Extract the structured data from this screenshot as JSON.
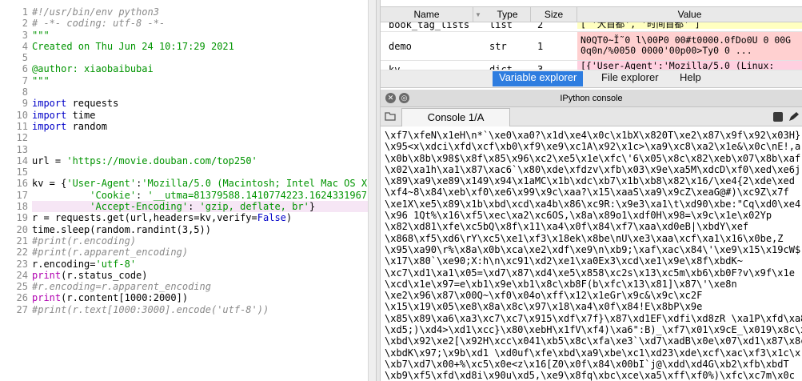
{
  "editor": {
    "lines": [
      {
        "n": "1",
        "parts": [
          {
            "c": "cm",
            "t": "#!/usr/bin/env python3"
          }
        ]
      },
      {
        "n": "2",
        "parts": [
          {
            "c": "cm",
            "t": "# -*- coding: utf-8 -*-"
          }
        ]
      },
      {
        "n": "3",
        "parts": [
          {
            "c": "str",
            "t": "\"\"\""
          }
        ]
      },
      {
        "n": "4",
        "parts": [
          {
            "c": "str",
            "t": "Created on Thu Jun 24 10:17:29 2021"
          }
        ]
      },
      {
        "n": "5",
        "parts": []
      },
      {
        "n": "6",
        "parts": [
          {
            "c": "str",
            "t": "@author: xiaobaibubai"
          }
        ]
      },
      {
        "n": "7",
        "parts": [
          {
            "c": "str",
            "t": "\"\"\""
          }
        ]
      },
      {
        "n": "8",
        "parts": []
      },
      {
        "n": "9",
        "parts": [
          {
            "c": "kw",
            "t": "import"
          },
          {
            "c": "",
            "t": " requests"
          }
        ]
      },
      {
        "n": "10",
        "parts": [
          {
            "c": "kw",
            "t": "import"
          },
          {
            "c": "",
            "t": " time"
          }
        ]
      },
      {
        "n": "11",
        "parts": [
          {
            "c": "kw",
            "t": "import"
          },
          {
            "c": "",
            "t": " random"
          }
        ]
      },
      {
        "n": "12",
        "parts": []
      },
      {
        "n": "13",
        "parts": []
      },
      {
        "n": "14",
        "parts": [
          {
            "c": "",
            "t": "url = "
          },
          {
            "c": "str",
            "t": "'https://movie.douban.com/top250'"
          }
        ]
      },
      {
        "n": "15",
        "parts": []
      },
      {
        "n": "16",
        "parts": [
          {
            "c": "",
            "t": "kv = {"
          },
          {
            "c": "str",
            "t": "'User-Agent'"
          },
          {
            "c": "",
            "t": ":"
          },
          {
            "c": "str",
            "t": "'Mozilla/5.0 (Macintosh; Intel Mac OS X"
          }
        ]
      },
      {
        "n": "17",
        "parts": [
          {
            "c": "",
            "t": "          "
          },
          {
            "c": "str",
            "t": "'Cookie'"
          },
          {
            "c": "",
            "t": ": "
          },
          {
            "c": "str",
            "t": "'__utma=81379588.1410774223.1624331967"
          }
        ]
      },
      {
        "n": "18",
        "hl": true,
        "parts": [
          {
            "c": "",
            "t": "          "
          },
          {
            "c": "str",
            "t": "'Accept-Encoding'"
          },
          {
            "c": "",
            "t": ": "
          },
          {
            "c": "str",
            "t": "'gzip, deflate, br'"
          },
          {
            "c": "",
            "t": "}"
          }
        ]
      },
      {
        "n": "19",
        "parts": [
          {
            "c": "",
            "t": "r = requests.get(url,headers=kv,verify="
          },
          {
            "c": "kw",
            "t": "False"
          },
          {
            "c": "",
            "t": ")"
          }
        ]
      },
      {
        "n": "20",
        "parts": [
          {
            "c": "",
            "t": "time.sleep(random.randint(3,5))"
          }
        ]
      },
      {
        "n": "21",
        "parts": [
          {
            "c": "cm",
            "t": "#print(r.encoding)"
          }
        ]
      },
      {
        "n": "22",
        "parts": [
          {
            "c": "cm",
            "t": "#print(r.apparent_encoding)"
          }
        ]
      },
      {
        "n": "23",
        "parts": [
          {
            "c": "",
            "t": "r.encoding="
          },
          {
            "c": "str",
            "t": "'utf-8'"
          }
        ]
      },
      {
        "n": "24",
        "parts": [
          {
            "c": "ca",
            "t": "print"
          },
          {
            "c": "",
            "t": "(r.status_code)"
          }
        ]
      },
      {
        "n": "25",
        "parts": [
          {
            "c": "cm",
            "t": "#r.encoding=r.apparent_encoding"
          }
        ]
      },
      {
        "n": "26",
        "parts": [
          {
            "c": "ca",
            "t": "print"
          },
          {
            "c": "",
            "t": "(r.content[1000:2000])"
          }
        ]
      },
      {
        "n": "27",
        "parts": [
          {
            "c": "cm",
            "t": "#print(r.text[1000:3000].encode('utf-8'))"
          }
        ]
      }
    ]
  },
  "variable_explorer": {
    "columns": {
      "name": "Name",
      "type": "Type",
      "size": "Size",
      "value": "Value"
    },
    "rows": [
      {
        "name": "book_tag_lists",
        "type": "list",
        "size": "2",
        "value": "[ '大首都', '时间首都' ]",
        "color": "yellow"
      },
      {
        "name": "demo",
        "type": "str",
        "size": "1",
        "value": "N0QT0~Ĭ̃ 0 l\\00P0 00#t0000.0fDo0U 0 00G\n0q0n/%0050 0000'00p00>Ty0 0 ...",
        "color": "red"
      },
      {
        "name": "kv",
        "type": "dict",
        "size": "3",
        "value": "[{'User-Agent':'Mozilla/5.0 (Linux:",
        "color": "pink"
      }
    ]
  },
  "pane_tabs": [
    "Variable explorer",
    "File explorer",
    "Help"
  ],
  "console": {
    "title": "IPython console",
    "tab_label": "Console 1/A",
    "output": [
      "\\xf7\\xfeN\\x1eH\\n*`\\xe0\\xa0?\\x1d\\xe4\\x0c\\x1bX\\x820T\\xe2\\x87\\x9f\\x92\\x03H}",
      "\\x95<x\\xdci\\xfd\\xcf\\xb0\\xf9\\xe9\\xc1A\\x92\\x1c>\\xa9\\xc8\\xa2\\x1e&\\x0c\\nE!,a",
      "\\x0b\\x8b\\x98$\\x8f\\x85\\x96\\xc2\\xe5\\x1e\\xfc\\'6\\x05\\x8c\\x82\\xeb\\x07\\x8b\\xaf",
      "\\x02\\xa1h\\xa1\\x87\\xac6`\\x80\\xde\\xfdzv\\xfb\\x03\\x9e\\xa5M\\xdcD\\xf0\\xed\\xe6j",
      "\\x89\\xa9\\xe89\\x149\\x94\\x1aMC\\x1b\\xdc\\xb7\\x1b\\xb8\\x82\\x16/\\xe4{2\\xde\\xed",
      "\\xf4~8\\x84\\xeb\\xf0\\xe6\\x99\\x9c\\xaa?\\x15\\xaaS\\xa9\\x9cZ\\xeaG@#)\\xc9Z\\x7f",
      "\\xe1X\\xe5\\x89\\x1b\\xbd\\xcd\\xa4b\\x86\\xc9R:\\x9e3\\xa1\\t\\xd90\\xbe:\"Cq\\xd0\\xe4",
      "\\x96 1Qt%\\x16\\xf5\\xec\\xa2\\xc6OS,\\x8a\\x89o1\\xdf0H\\x98=\\x9c\\x1e\\x02Yp",
      "\\x82\\xd81\\xfe\\xc5bQ\\x8f\\x11\\xa4\\x0f\\x84\\xf7\\xaa\\xd0eB|\\xbdY\\xef",
      "\\x868\\xf5\\xd6\\rY\\xc5\\xe1\\xf3\\x18ek\\x8be\\nU\\xe3\\xaa\\xcf\\xa1\\x16\\x0be,Z",
      "\\x95\\xa90\\r%\\x8a\\x0b\\xca\\xe2\\xdf\\xe9\\n\\xb9;\\xaf\\xac\\x84\\'\\xe9\\x15\\x19cW$",
      "\\x17\\x80`\\xe90;X:h\\n\\xc91\\xd2\\xe1\\xa0Ex3\\xcd\\xe1\\x9e\\x8f\\xbdK~",
      "\\xc7\\xd1\\xa1\\x05=\\xd7\\x87\\xd4\\xe5\\x858\\xc2s\\x13\\xc5m\\xb6\\xb0F?v\\x9f\\x1e",
      "\\xcd\\x1e\\x97=e\\xb1\\x9e\\xb1\\x8c\\xb8F(b\\xfc\\x13\\x81]\\x87\\'\\xe8n",
      "\\xe2\\x96\\x87\\x00Q~\\xf0\\x04o\\xff\\x12\\x1eGr\\x9c&\\x9c\\xc2F",
      "\\x15\\x19\\x05\\xe8\\x8a\\x8c\\x97\\x18\\xa4\\x0f\\x84!E\\x8bP\\x9e",
      "\\x85\\x89\\xa6\\xa3\\xc7\\xc7\\x915\\xdf\\x7f}\\x87\\xd1EF\\xdfi\\xd8zR \\xa1P\\xfd\\xa8",
      "\\xd5;)\\xd4>\\xd1\\xcc}\\x80\\xebH\\x1fV\\xf4)\\xa6\":B)_\\xf7\\x01\\x9cE_\\x019\\x8c\\x8f",
      "\\xbd\\x92\\xe2[\\x92H\\xcc\\x041\\xb5\\x8c\\xfa\\xe3`\\xd7\\xadB\\x0e\\x07\\xd1\\x87\\x8c",
      "\\xbdK\\x97;\\x9b\\xd1 \\xd0uf\\xfe\\xbd\\xa9\\xbe\\xc1\\xd23\\xde\\xcf\\xac\\xf3\\x1c\\x",
      "\\xb7\\xd7\\x00+%\\xc5\\x0e<z\\x16[Z0\\x0f\\x84\\x00bI`j@\\xdd\\xd4G\\xb2\\xfb\\xbdT",
      "\\xb9\\xf5\\xfd\\xd8i\\x90u\\xd5,\\xe9\\x8fq\\xbc\\xce\\xa5\\xff\\xf0%)\\xfc\\xc7m\\x0c"
    ]
  },
  "colors": {
    "string": "#009400",
    "keyword": "#0000c8",
    "comment": "#8a8a8a",
    "callable": "#b000b0",
    "active_tab": "#2e7de0",
    "current_line": "#f6e6f5"
  }
}
